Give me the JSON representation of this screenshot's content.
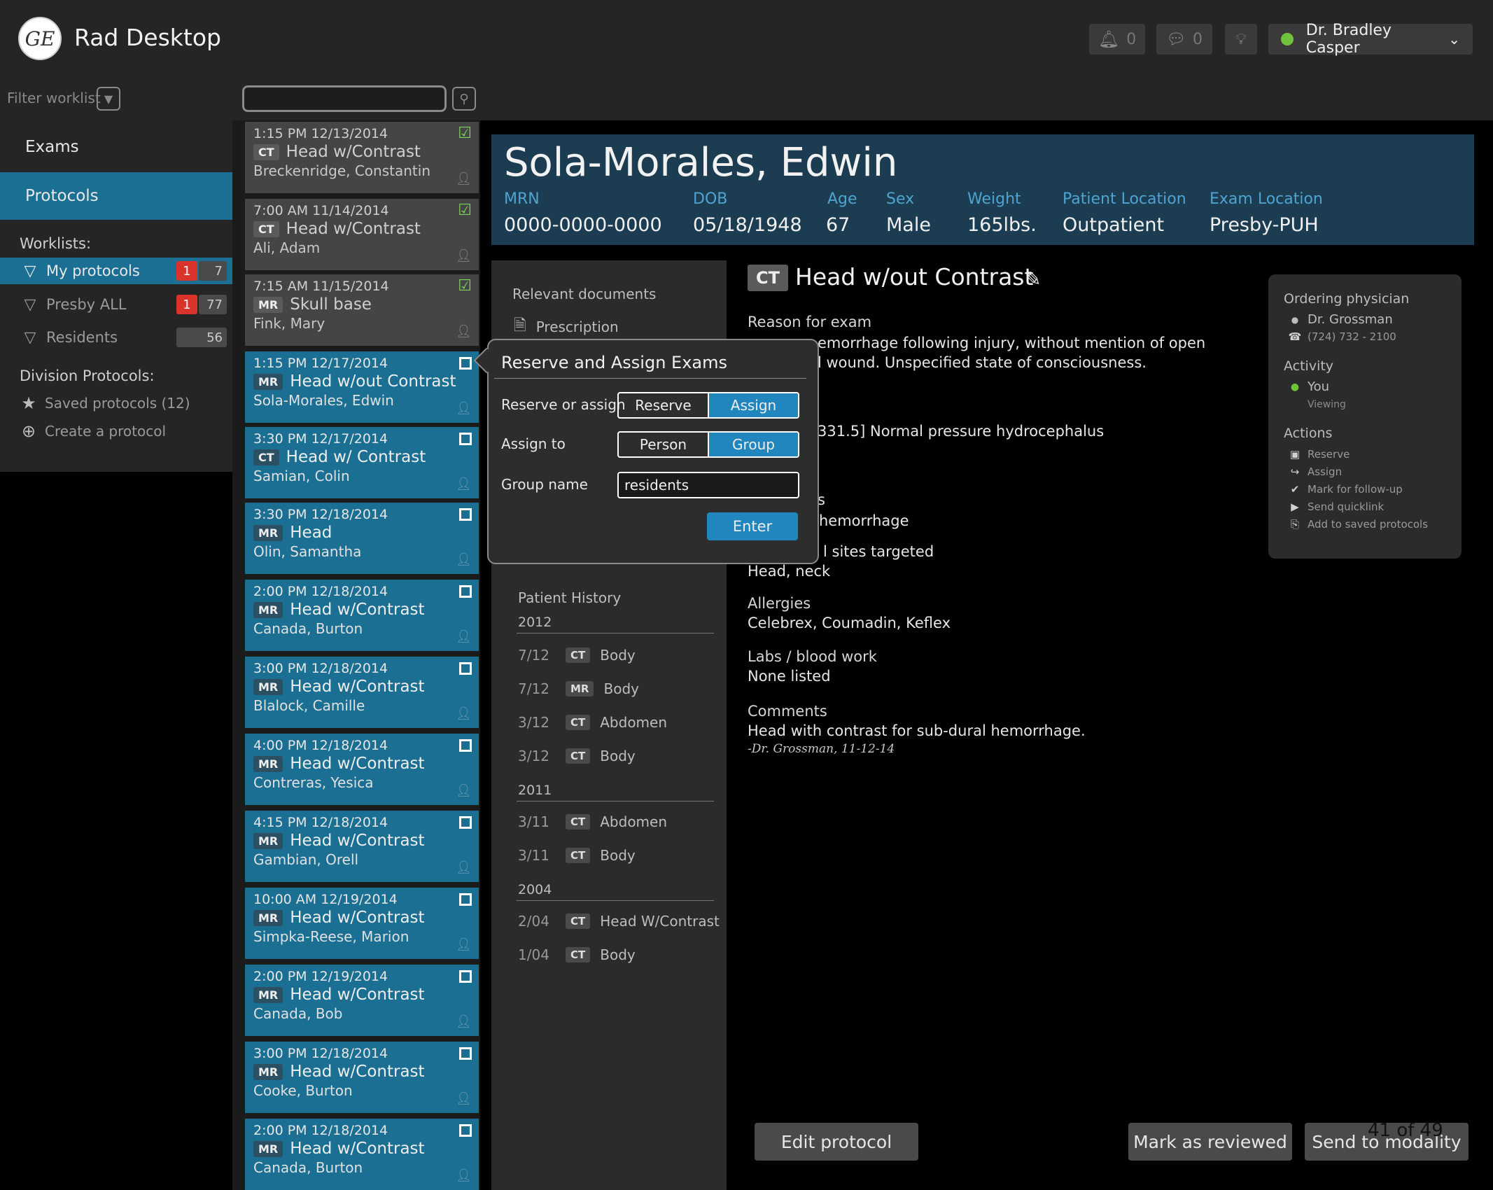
{
  "app": {
    "title": "Rad Desktop",
    "logo_text": "GE"
  },
  "topbar": {
    "notifications": {
      "icon": "bell-icon",
      "count": "0"
    },
    "messages": {
      "icon": "chat-icon",
      "count": "0"
    },
    "tips": {
      "icon": "lightbulb-icon"
    },
    "user": {
      "name": "Dr. Bradley Casper",
      "status_color": "#6fc33a"
    }
  },
  "filter": {
    "label": "Filter worklist",
    "search_value": ""
  },
  "nav": {
    "exams": "Exams",
    "protocols": "Protocols"
  },
  "worklists": {
    "label": "Worklists:",
    "items": [
      {
        "label": "My protocols",
        "urgent": "1",
        "count": "7"
      },
      {
        "label": "Presby ALL",
        "urgent": "1",
        "count": "77"
      },
      {
        "label": "Residents",
        "count": "56"
      }
    ]
  },
  "division": {
    "label": "Division Protocols:",
    "saved": "Saved protocols (12)",
    "create": "Create a protocol"
  },
  "cards": [
    {
      "time": "1:15 PM 12/13/2014",
      "mod": "CT",
      "exam": "Head w/Contrast",
      "patient": "Breckenridge, Constantin",
      "done": true
    },
    {
      "time": "7:00 AM 11/14/2014",
      "mod": "CT",
      "exam": "Head w/Contrast",
      "patient": "Ali, Adam",
      "done": true
    },
    {
      "time": "7:15 AM 11/15/2014",
      "mod": "MR",
      "exam": "Skull base",
      "patient": "Fink, Mary",
      "done": true
    },
    {
      "time": "1:15 PM 12/17/2014",
      "mod": "MR",
      "exam": "Head w/out Contrast",
      "patient": "Sola-Morales, Edwin",
      "done": false
    },
    {
      "time": "3:30 PM 12/17/2014",
      "mod": "CT",
      "exam": "Head w/ Contrast",
      "patient": "Samian, Colin",
      "done": false
    },
    {
      "time": "3:30 PM 12/18/2014",
      "mod": "MR",
      "exam": "Head",
      "patient": "Olin, Samantha",
      "done": false
    },
    {
      "time": "2:00 PM 12/18/2014",
      "mod": "MR",
      "exam": "Head  w/Contrast",
      "patient": "Canada, Burton",
      "done": false
    },
    {
      "time": "3:00 PM 12/18/2014",
      "mod": "MR",
      "exam": "Head  w/Contrast",
      "patient": "Blalock, Camille",
      "done": false
    },
    {
      "time": "4:00 PM 12/18/2014",
      "mod": "MR",
      "exam": "Head  w/Contrast",
      "patient": "Contreras, Yesica",
      "done": false
    },
    {
      "time": "4:15 PM 12/18/2014",
      "mod": "MR",
      "exam": "Head  w/Contrast",
      "patient": "Gambian, Orell",
      "done": false
    },
    {
      "time": "10:00 AM 12/19/2014",
      "mod": "MR",
      "exam": "Head  w/Contrast",
      "patient": "Simpka-Reese, Marion",
      "done": false
    },
    {
      "time": "2:00 PM 12/19/2014",
      "mod": "MR",
      "exam": "Head  w/Contrast",
      "patient": "Canada, Bob",
      "done": false
    },
    {
      "time": "3:00 PM 12/18/2014",
      "mod": "MR",
      "exam": "Head  w/Contrast",
      "patient": "Cooke, Burton",
      "done": false
    },
    {
      "time": "2:00 PM 12/18/2014",
      "mod": "MR",
      "exam": "Head  w/Contrast",
      "patient": "Canada, Burton",
      "done": false
    }
  ],
  "patient": {
    "name": "Sola-Morales, Edwin",
    "fields": [
      {
        "label": "MRN",
        "value": "0000-0000-0000"
      },
      {
        "label": "DOB",
        "value": "05/18/1948"
      },
      {
        "label": "Age",
        "value": "67"
      },
      {
        "label": "Sex",
        "value": "Male"
      },
      {
        "label": "Weight",
        "value": "165lbs."
      },
      {
        "label": "Patient Location",
        "value": "Outpatient"
      },
      {
        "label": "Exam Location",
        "value": "Presby-PUH"
      }
    ]
  },
  "docs": {
    "label": "Relevant documents",
    "prescription": "Prescription"
  },
  "history": {
    "label": "Patient History",
    "groups": [
      {
        "year": "2012",
        "items": [
          {
            "date": "7/12",
            "mod": "CT",
            "exam": "Body"
          },
          {
            "date": "7/12",
            "mod": "MR",
            "exam": "Body"
          },
          {
            "date": "3/12",
            "mod": "CT",
            "exam": "Abdomen"
          },
          {
            "date": "3/12",
            "mod": "CT",
            "exam": "Body"
          }
        ]
      },
      {
        "year": "2011",
        "items": [
          {
            "date": "3/11",
            "mod": "CT",
            "exam": "Abdomen"
          },
          {
            "date": "3/11",
            "mod": "CT",
            "exam": "Body"
          }
        ]
      },
      {
        "year": "2004",
        "items": [
          {
            "date": "2/04",
            "mod": "CT",
            "exam": "Head W/Contrast"
          },
          {
            "date": "1/04",
            "mod": "CT",
            "exam": "Body"
          }
        ]
      }
    ]
  },
  "exam": {
    "mod": "CT",
    "title": "Head w/out Contrast",
    "reason_label": "Reason for exam",
    "reason_line1": "emorrhage following injury, without mention of open",
    "reason_line2": "l wound.  Unspecified state of consciousness.",
    "dx_line": "331.5] Normal pressure hydrocephalus",
    "partial_s": "s",
    "hemorrhage": "hemorrhage",
    "sites_partial": "l sites targeted",
    "sites_value": "Head, neck",
    "allergies_label": "Allergies",
    "allergies_value": "Celebrex, Coumadin, Keflex",
    "labs_label": "Labs / blood work",
    "labs_value": "None listed",
    "comments_label": "Comments",
    "comments_value": "Head with contrast for sub-dural hemorrhage.",
    "comments_author": "-Dr. Grossman, 11-12-14"
  },
  "info": {
    "ordering_label": "Ordering physician",
    "ordering_name": "Dr. Grossman",
    "ordering_phone": "(724) 732 - 2100",
    "activity_label": "Activity",
    "activity_user": "You",
    "activity_state": "Viewing",
    "actions_label": "Actions",
    "actions": [
      {
        "icon": "reserve-icon",
        "label": "Reserve"
      },
      {
        "icon": "assign-icon",
        "label": "Assign"
      },
      {
        "icon": "check-circle-icon",
        "label": "Mark for follow-up"
      },
      {
        "icon": "send-icon",
        "label": "Send quicklink"
      },
      {
        "icon": "save-icon",
        "label": "Add to saved protocols"
      }
    ]
  },
  "popup": {
    "title": "Reserve and Assign Exams",
    "reserve_label": "Reserve or assign",
    "reserve_opt": "Reserve",
    "assign_opt": "Assign",
    "assign_label": "Assign to",
    "person_opt": "Person",
    "group_opt": "Group",
    "group_label": "Group name",
    "group_value": "residents",
    "enter": "Enter"
  },
  "footer": {
    "edit": "Edit protocol",
    "review": "Mark as reviewed",
    "send": "Send to modality",
    "pager": "41 of 49"
  },
  "colors": {
    "accent": "#1a6f93",
    "button_blue": "#2186bd",
    "urgent": "#d9332b",
    "done_check": "#7ed35a",
    "header_bg": "#1c3d51",
    "label_blue": "#4fa3d1"
  }
}
